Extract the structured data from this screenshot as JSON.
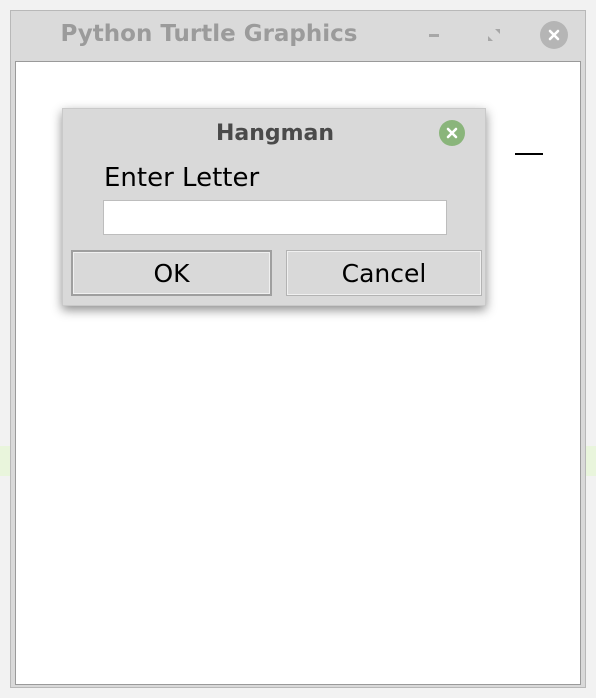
{
  "window": {
    "title": "Python Turtle Graphics",
    "controls": {
      "minimize_icon": "minimize-icon",
      "maximize_icon": "maximize-icon",
      "close_icon": "close-icon"
    }
  },
  "canvas": {
    "word_blanks": [
      "_"
    ]
  },
  "dialog": {
    "title": "Hangman",
    "prompt": "Enter Letter",
    "input_value": "",
    "ok_label": "OK",
    "cancel_label": "Cancel",
    "close_icon": "close-icon",
    "close_color": "#8ab57b"
  }
}
